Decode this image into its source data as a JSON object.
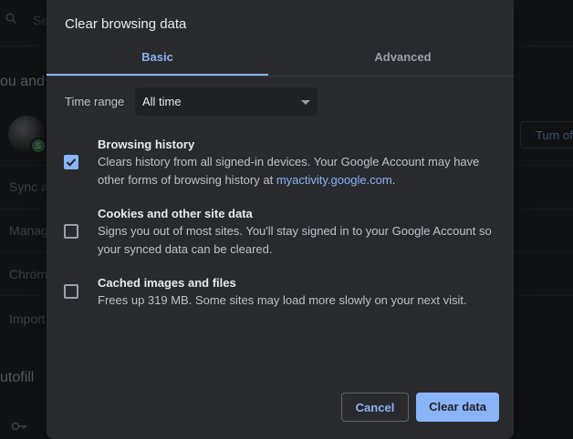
{
  "background": {
    "search_placeholder": "Se",
    "section_you": "ou and G",
    "sync": "Sync a",
    "manage": "Manag",
    "chrome": "Chrom",
    "import": "Import",
    "autofill": "utofill",
    "turn_off": "Turn of"
  },
  "dialog": {
    "title": "Clear browsing data",
    "tabs": [
      {
        "label": "Basic",
        "active": true
      },
      {
        "label": "Advanced",
        "active": false
      }
    ],
    "time_range": {
      "label": "Time range",
      "value": "All time"
    },
    "items": [
      {
        "title": "Browsing history",
        "checked": true,
        "desc_before": "Clears history from all signed-in devices. Your Google Account may have other forms of browsing history at ",
        "link": "myactivity.google.com",
        "desc_after": "."
      },
      {
        "title": "Cookies and other site data",
        "checked": false,
        "desc": "Signs you out of most sites. You'll stay signed in to your Google Account so your synced data can be cleared."
      },
      {
        "title": "Cached images and files",
        "checked": false,
        "desc": "Frees up 319 MB. Some sites may load more slowly on your next visit."
      }
    ],
    "buttons": {
      "cancel": "Cancel",
      "clear": "Clear data"
    }
  },
  "colors": {
    "accent": "#8ab4f8",
    "dialog_bg": "#292a2d",
    "page_bg": "#202124"
  }
}
